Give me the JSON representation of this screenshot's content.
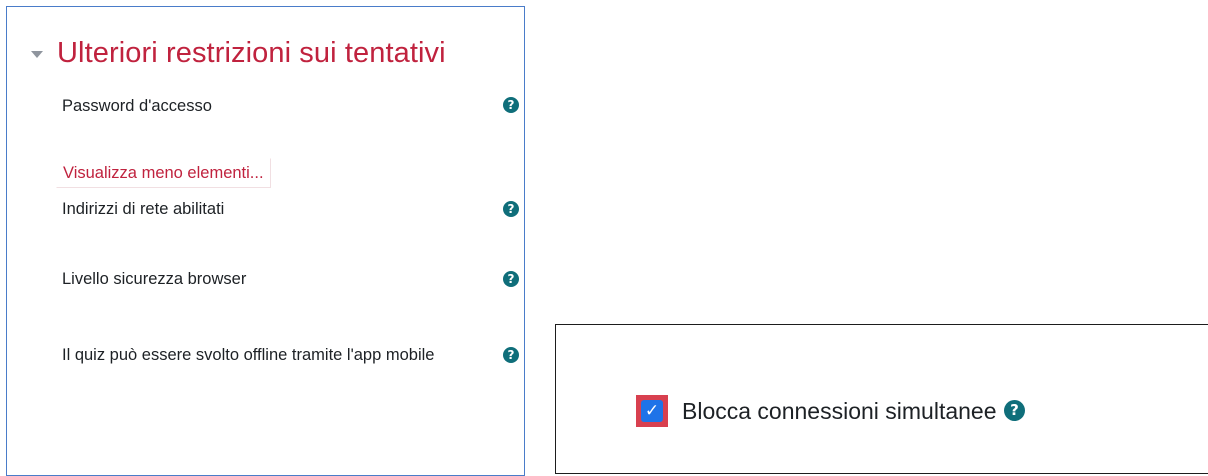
{
  "section": {
    "title": "Ulteriori restrizioni sui tentativi",
    "caret_icon": "caret-down-icon"
  },
  "fields": {
    "password": {
      "label": "Password d'accesso",
      "help": "?"
    },
    "show_less_link": "Visualizza meno elementi...",
    "network": {
      "label": "Indirizzi di rete abilitati",
      "help": "?"
    },
    "browser_security": {
      "label": "Livello sicurezza browser",
      "help": "?"
    },
    "offline": {
      "label": "Il quiz può essere svolto offline tramite l'app mobile",
      "help": "?"
    }
  },
  "callout": {
    "checkbox_checked": true,
    "checkbox_label": "Blocca connessioni simultanee",
    "help": "?"
  },
  "colors": {
    "accent_red": "#c0223e",
    "help_icon": "#0f6e7a",
    "checkbox_blue": "#1e73e8",
    "highlight_red": "#d8404f",
    "panel_border": "#4a7cc9"
  }
}
